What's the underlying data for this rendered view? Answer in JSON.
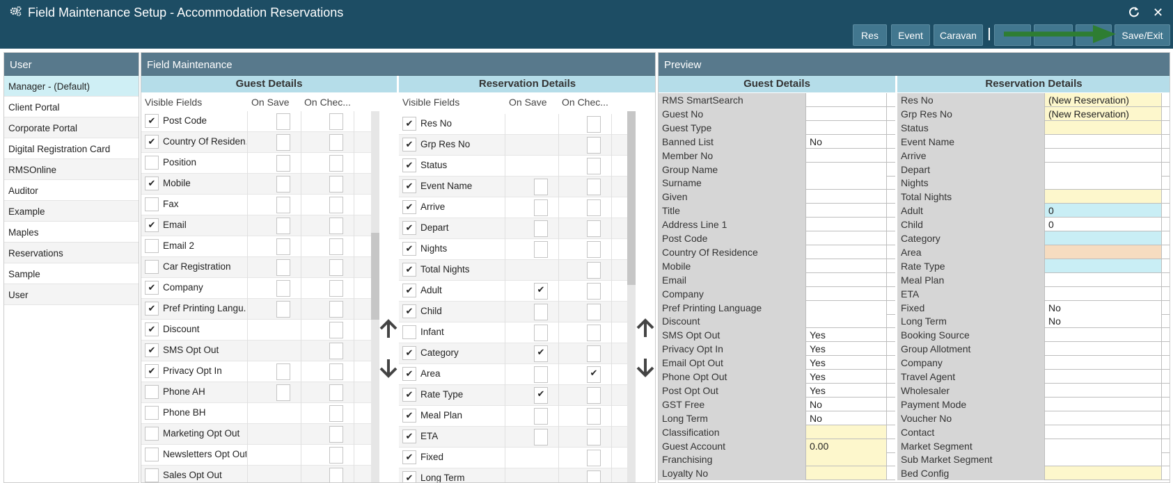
{
  "title": "Field Maintenance Setup - Accommodation Reservations",
  "icons": {
    "app": "gears-icon",
    "refresh": "refresh-icon",
    "close": "close-icon"
  },
  "toolbar": {
    "res": "Res",
    "event": "Event",
    "caravan": "Caravan",
    "save_exit": "Save/Exit"
  },
  "user_panel": {
    "title": "User",
    "items": [
      "Manager - (Default)",
      "Client Portal",
      "Corporate Portal",
      "Digital Registration Card",
      "RMSOnline",
      "Auditor",
      "Example",
      "Maples",
      "Reservations",
      "Sample",
      "User"
    ]
  },
  "field_maintenance": {
    "title": "Field Maintenance",
    "guest": {
      "title": "Guest Details",
      "columns": [
        "Visible Fields",
        "On Save",
        "On Chec..."
      ],
      "rows": [
        {
          "label": "Post Code",
          "visible": true,
          "on_save": false,
          "on_check": false
        },
        {
          "label": "Country Of Residen...",
          "visible": true,
          "on_save": false,
          "on_check": false
        },
        {
          "label": "Position",
          "visible": false,
          "on_save": false,
          "on_check": false
        },
        {
          "label": "Mobile",
          "visible": true,
          "on_save": false,
          "on_check": false
        },
        {
          "label": "Fax",
          "visible": false,
          "on_save": false,
          "on_check": false
        },
        {
          "label": "Email",
          "visible": true,
          "on_save": false,
          "on_check": false
        },
        {
          "label": "Email 2",
          "visible": false,
          "on_save": false,
          "on_check": false
        },
        {
          "label": "Car Registration",
          "visible": false,
          "on_save": false,
          "on_check": false
        },
        {
          "label": "Company",
          "visible": true,
          "on_save": false,
          "on_check": false
        },
        {
          "label": "Pref Printing Langu...",
          "visible": true,
          "on_save": false,
          "on_check": false
        },
        {
          "label": "Discount",
          "visible": true,
          "on_save": null,
          "on_check": false
        },
        {
          "label": "SMS Opt Out",
          "visible": true,
          "on_save": null,
          "on_check": false
        },
        {
          "label": "Privacy Opt In",
          "visible": true,
          "on_save": false,
          "on_check": false
        },
        {
          "label": "Phone AH",
          "visible": false,
          "on_save": false,
          "on_check": false
        },
        {
          "label": "Phone BH",
          "visible": false,
          "on_save": null,
          "on_check": false
        },
        {
          "label": "Marketing Opt Out",
          "visible": false,
          "on_save": null,
          "on_check": false
        },
        {
          "label": "Newsletters Opt Out",
          "visible": false,
          "on_save": null,
          "on_check": false
        },
        {
          "label": "Sales Opt Out",
          "visible": false,
          "on_save": null,
          "on_check": false
        }
      ]
    },
    "reservation": {
      "title": "Reservation Details",
      "columns": [
        "Visible Fields",
        "On Save",
        "On Chec..."
      ],
      "rows": [
        {
          "label": "Res No",
          "visible": true,
          "on_save": null,
          "on_check": false
        },
        {
          "label": "Grp Res No",
          "visible": true,
          "on_save": null,
          "on_check": false
        },
        {
          "label": "Status",
          "visible": true,
          "on_save": null,
          "on_check": false
        },
        {
          "label": "Event Name",
          "visible": true,
          "on_save": false,
          "on_check": false
        },
        {
          "label": "Arrive",
          "visible": true,
          "on_save": false,
          "on_check": false
        },
        {
          "label": "Depart",
          "visible": true,
          "on_save": false,
          "on_check": false
        },
        {
          "label": "Nights",
          "visible": true,
          "on_save": false,
          "on_check": false
        },
        {
          "label": "Total Nights",
          "visible": true,
          "on_save": null,
          "on_check": false
        },
        {
          "label": "Adult",
          "visible": true,
          "on_save": true,
          "on_check": false
        },
        {
          "label": "Child",
          "visible": true,
          "on_save": false,
          "on_check": false
        },
        {
          "label": "Infant",
          "visible": false,
          "on_save": false,
          "on_check": false
        },
        {
          "label": "Category",
          "visible": true,
          "on_save": true,
          "on_check": false
        },
        {
          "label": "Area",
          "visible": true,
          "on_save": false,
          "on_check": true
        },
        {
          "label": "Rate Type",
          "visible": true,
          "on_save": true,
          "on_check": false
        },
        {
          "label": "Meal Plan",
          "visible": true,
          "on_save": false,
          "on_check": false
        },
        {
          "label": "ETA",
          "visible": true,
          "on_save": false,
          "on_check": false
        },
        {
          "label": "Fixed",
          "visible": true,
          "on_save": null,
          "on_check": false
        },
        {
          "label": "Long Term",
          "visible": true,
          "on_save": null,
          "on_check": false
        }
      ]
    }
  },
  "preview": {
    "title": "Preview",
    "guest": {
      "title": "Guest Details",
      "rows": [
        {
          "label": "RMS SmartSearch",
          "value": "",
          "bg": "white"
        },
        {
          "label": "Guest No",
          "value": "",
          "bg": "white"
        },
        {
          "label": "Guest Type",
          "value": "",
          "bg": "white"
        },
        {
          "label": "Banned List",
          "value": "No",
          "bg": "white"
        },
        {
          "label": "Member No",
          "value": "",
          "bg": "white"
        },
        {
          "label": "Group Name",
          "value": "",
          "bg": "white"
        },
        {
          "label": "Surname",
          "value": "",
          "bg": "white"
        },
        {
          "label": "Given",
          "value": "",
          "bg": "white"
        },
        {
          "label": "Title",
          "value": "",
          "bg": "white"
        },
        {
          "label": "Address Line 1",
          "value": "",
          "bg": "white"
        },
        {
          "label": "Post Code",
          "value": "",
          "bg": "white"
        },
        {
          "label": "Country Of Residence",
          "value": "",
          "bg": "white"
        },
        {
          "label": "Mobile",
          "value": "",
          "bg": "white"
        },
        {
          "label": "Email",
          "value": "",
          "bg": "white"
        },
        {
          "label": "Company",
          "value": "",
          "bg": "white"
        },
        {
          "label": "Pref Printing Language",
          "value": "",
          "bg": "white"
        },
        {
          "label": "Discount",
          "value": "",
          "bg": "white"
        },
        {
          "label": "SMS Opt Out",
          "value": "Yes",
          "bg": "white"
        },
        {
          "label": "Privacy Opt In",
          "value": "Yes",
          "bg": "white"
        },
        {
          "label": "Email Opt Out",
          "value": "Yes",
          "bg": "white"
        },
        {
          "label": "Phone Opt Out",
          "value": "Yes",
          "bg": "white"
        },
        {
          "label": "Post Opt Out",
          "value": "Yes",
          "bg": "white"
        },
        {
          "label": "GST Free",
          "value": "No",
          "bg": "white"
        },
        {
          "label": "Long Term",
          "value": "No",
          "bg": "white"
        },
        {
          "label": "Classification",
          "value": "",
          "bg": "yellow"
        },
        {
          "label": "Guest Account",
          "value": "0.00",
          "bg": "yellow"
        },
        {
          "label": "Franchising",
          "value": "",
          "bg": "yellow"
        },
        {
          "label": "Loyalty No",
          "value": "",
          "bg": "yellow"
        }
      ]
    },
    "reservation": {
      "title": "Reservation Details",
      "rows": [
        {
          "label": "Res No",
          "value": "(New Reservation)",
          "bg": "yellow"
        },
        {
          "label": "Grp Res No",
          "value": "(New Reservation)",
          "bg": "yellow"
        },
        {
          "label": "Status",
          "value": "",
          "bg": "yellow"
        },
        {
          "label": "Event Name",
          "value": "",
          "bg": "white"
        },
        {
          "label": "Arrive",
          "value": "",
          "bg": "white"
        },
        {
          "label": "Depart",
          "value": "",
          "bg": "white"
        },
        {
          "label": "Nights",
          "value": "",
          "bg": "white"
        },
        {
          "label": "Total Nights",
          "value": "",
          "bg": "yellow"
        },
        {
          "label": "Adult",
          "value": "0",
          "bg": "blue"
        },
        {
          "label": "Child",
          "value": "0",
          "bg": "white"
        },
        {
          "label": "Category",
          "value": "",
          "bg": "blue"
        },
        {
          "label": "Area",
          "value": "",
          "bg": "peach"
        },
        {
          "label": "Rate Type",
          "value": "",
          "bg": "blue"
        },
        {
          "label": "Meal Plan",
          "value": "",
          "bg": "white"
        },
        {
          "label": "ETA",
          "value": "",
          "bg": "white"
        },
        {
          "label": "Fixed",
          "value": "No",
          "bg": "white"
        },
        {
          "label": "Long Term",
          "value": "No",
          "bg": "white"
        },
        {
          "label": "Booking Source",
          "value": "",
          "bg": "white"
        },
        {
          "label": "Group Allotment",
          "value": "",
          "bg": "white"
        },
        {
          "label": "Company",
          "value": "",
          "bg": "white"
        },
        {
          "label": "Travel Agent",
          "value": "",
          "bg": "white"
        },
        {
          "label": "Wholesaler",
          "value": "",
          "bg": "white"
        },
        {
          "label": "Payment Mode",
          "value": "",
          "bg": "white"
        },
        {
          "label": "Voucher No",
          "value": "",
          "bg": "white"
        },
        {
          "label": "Contact",
          "value": "",
          "bg": "white"
        },
        {
          "label": "Market Segment",
          "value": "",
          "bg": "white"
        },
        {
          "label": "Sub Market Segment",
          "value": "",
          "bg": "white"
        },
        {
          "label": "Bed Config",
          "value": "",
          "bg": "yellow"
        }
      ]
    }
  },
  "colors": {
    "titlebar": "#1d4d64",
    "toolbar_button": "#42778f",
    "panel_header": "#58798c",
    "section_header": "#b5dde9",
    "selected_row": "#cfeff5",
    "yellow": "#fdf7cc",
    "blue": "#c9eef5",
    "peach": "#f6dcc0",
    "white": "#ffffff",
    "arrow": "#2e7d32"
  }
}
